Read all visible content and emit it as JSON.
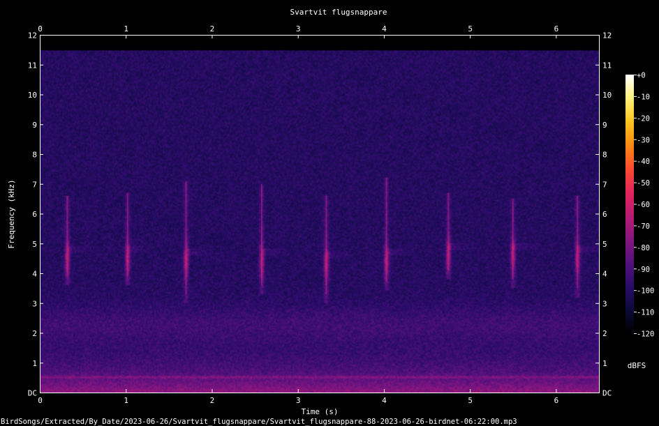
{
  "chart_data": {
    "type": "heatmap",
    "title": "Svartvit flugsnappare",
    "xlabel": "Time (s)",
    "ylabel": "Frequency (kHz)",
    "xlim": [
      0,
      6.5
    ],
    "ylim": [
      0,
      12
    ],
    "x_ticks": [
      "0",
      "1",
      "2",
      "3",
      "4",
      "5",
      "6"
    ],
    "y_ticks": [
      "DC",
      "1",
      "2",
      "3",
      "4",
      "5",
      "6",
      "7",
      "8",
      "9",
      "10",
      "11",
      "12"
    ],
    "colorbar": {
      "unit": "dBFS",
      "range": [
        -120,
        0
      ],
      "ticks": [
        "+0",
        "-10",
        "-20",
        "-30",
        "-40",
        "-50",
        "-60",
        "-70",
        "-80",
        "-90",
        "-100",
        "-110",
        "-120"
      ],
      "colors": [
        "#000000",
        "#0c0a3a",
        "#2a0c6a",
        "#55117e",
        "#87167f",
        "#b81b72",
        "#e2255a",
        "#fb4b2f",
        "#fd8a13",
        "#fdc41e",
        "#fef07a",
        "#ffffff"
      ]
    },
    "signal_cutoff_khz": 11.5,
    "calls": [
      {
        "t": 0.32,
        "f_low": 3.9,
        "f_high": 6.6,
        "peak_f": 4.5
      },
      {
        "t": 1.02,
        "f_low": 3.9,
        "f_high": 6.7,
        "peak_f": 4.5
      },
      {
        "t": 1.7,
        "f_low": 3.3,
        "f_high": 7.1,
        "peak_f": 4.4
      },
      {
        "t": 2.58,
        "f_low": 3.6,
        "f_high": 7.0,
        "peak_f": 4.4
      },
      {
        "t": 3.33,
        "f_low": 3.3,
        "f_high": 6.6,
        "peak_f": 4.3
      },
      {
        "t": 4.03,
        "f_low": 3.7,
        "f_high": 7.2,
        "peak_f": 4.4
      },
      {
        "t": 4.75,
        "f_low": 4.1,
        "f_high": 6.7,
        "peak_f": 4.6
      },
      {
        "t": 5.5,
        "f_low": 3.8,
        "f_high": 6.5,
        "peak_f": 4.6
      },
      {
        "t": 6.25,
        "f_low": 3.5,
        "f_high": 6.6,
        "peak_f": 4.5
      }
    ]
  },
  "footer": {
    "file_path": "BirdSongs/Extracted/By_Date/2023-06-26/Svartvit_flugsnappare/Svartvit_flugsnappare-88-2023-06-26-birdnet-06:22:00.mp3"
  }
}
